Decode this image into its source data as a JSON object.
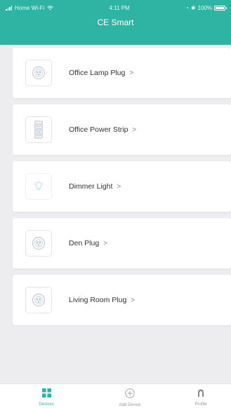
{
  "status_bar": {
    "carrier": "Home Wi-Fi",
    "time": "4:11 PM",
    "battery": "100%"
  },
  "header": {
    "title": "CE Smart"
  },
  "devices": [
    {
      "name": "Office Lamp Plug",
      "icon": "plug-icon"
    },
    {
      "name": "Office Power Strip",
      "icon": "power-strip-icon"
    },
    {
      "name": "Dimmer Light",
      "icon": "bulb-icon"
    },
    {
      "name": "Den Plug",
      "icon": "plug-icon"
    },
    {
      "name": "Living Room Plug",
      "icon": "plug-icon"
    }
  ],
  "chevron": ">",
  "tabs": [
    {
      "label": "Devices",
      "icon": "grid-icon"
    },
    {
      "label": "Add Device",
      "icon": "add-circle-icon"
    },
    {
      "label": "Profile",
      "icon": "person-icon"
    }
  ],
  "colors": {
    "accent": "#2fb3a3",
    "background": "#ededf0",
    "card": "#ffffff"
  }
}
